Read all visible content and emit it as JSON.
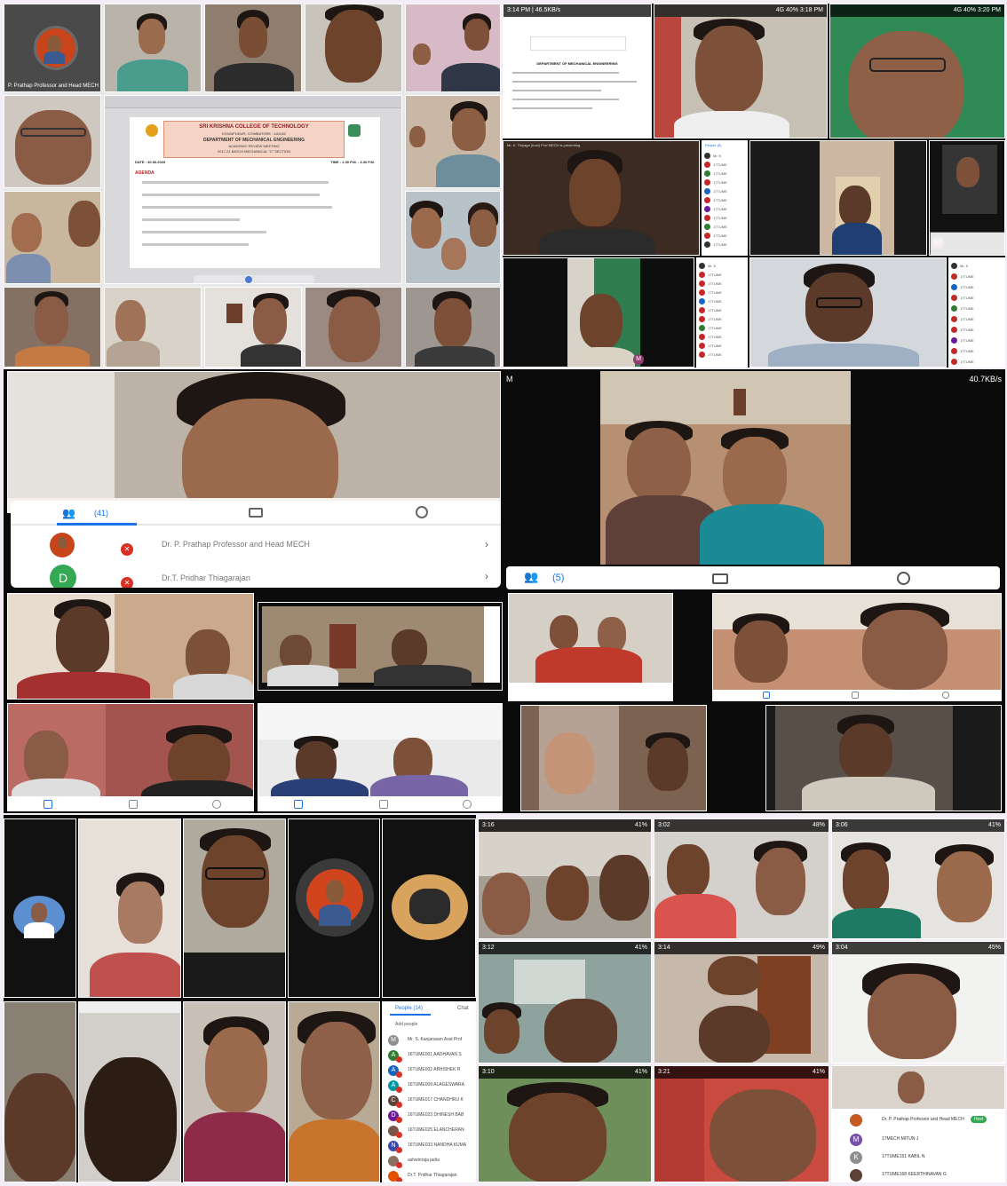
{
  "panel1": {
    "presenter_label": "P. Prathap Professor and Head MECH",
    "slide": {
      "college": "SRI KRISHNA COLLEGE OF TECHNOLOGY",
      "place": "KOVAIPUDUR, COIMBATORE - 641042",
      "dept": "DEPARTMENT OF MECHANICAL ENGINEERING",
      "meeting": "ACADEMIC REVIEW MEETING",
      "batch": "2017-21 BATCH MECHANICAL \"C\" SECTION",
      "date": "DATE : 30.06.2020",
      "time": "TIME : 2.30 P.M. - 3.30 P.M.",
      "agenda_title": "AGENDA",
      "agenda_items": [
        "",
        "",
        "",
        "",
        "",
        ""
      ]
    }
  },
  "panel2": {
    "status_left_1": "3:14 PM | 46.5KB/s",
    "status_right_1": "4G  40% 3:18 PM",
    "status_right_2": "4G  40% 3:20 PM",
    "doc_title": "DEPARTMENT OF MECHANICAL ENGINEERING",
    "presenting_label": "Mr. K. Thiyaga (host) Prof MECH is presenting",
    "people_label": "People (5)",
    "avatar_letter": "M"
  },
  "panel3": {
    "participants_count": "(41)",
    "participants": [
      {
        "name": "Dr. P. Prathap Professor and Head MECH",
        "avatar": ""
      },
      {
        "name": "Dr.T. Pridhar Thiagarajan",
        "avatar": "D"
      }
    ]
  },
  "panel4": {
    "status_left": "M",
    "status_right": "40.7KB/s",
    "participants_count": "(5)"
  },
  "panel6": {
    "status_times": [
      "3:16",
      "3:02",
      "3:06",
      "3:12",
      "3:14",
      "3:04",
      "3:10",
      "3:21"
    ],
    "battery": [
      "41%",
      "48%",
      "41%",
      "41%",
      "49%",
      "45%",
      "41%",
      "41%"
    ],
    "people_tab": "People (14)",
    "chat_tab": "Chat",
    "add_people": "Add people",
    "participants": [
      {
        "avatar": "M",
        "name": "Mr. S. Kanjarasan Asst Prof",
        "color": "#8e8e8e"
      },
      {
        "avatar": "A",
        "name": "16TUME001 AADHAVAN S",
        "color": "#2e7d32"
      },
      {
        "avatar": "A",
        "name": "16TUME002 ABHISHEK R",
        "color": "#1565c0"
      },
      {
        "avatar": "A",
        "name": "16TUME009 ALAGESWARA",
        "color": "#0097a7"
      },
      {
        "avatar": "C",
        "name": "16TUME017 CHANDHRU K",
        "color": "#5d4037"
      },
      {
        "avatar": "D",
        "name": "16TUME023 DHINESH BAB",
        "color": "#6a1b9a"
      },
      {
        "avatar": "",
        "name": "16TUME025 ELANCHERAN",
        "color": "#795548"
      },
      {
        "avatar": "N",
        "name": "16TUME033 NANDHA KUMA",
        "color": "#3949ab"
      },
      {
        "avatar": "",
        "name": "ashwinraja jadia",
        "color": "#8d6e63"
      },
      {
        "avatar": "",
        "name": "Dr.T. Pridhar Thiagarajan",
        "color": "#e65100"
      }
    ],
    "right_list": [
      {
        "avatar": "",
        "name": "Dr. P. Prathap Professor and Head MECH",
        "color": "#c45a20",
        "tag": "Host"
      },
      {
        "avatar": "M",
        "name": "17MECH MITUN J",
        "color": "#7b52ab"
      },
      {
        "avatar": "K",
        "name": "17TUME151 KABIL N",
        "color": "#8e8e8e"
      },
      {
        "avatar": "",
        "name": "17TUME168 KEERTHINAVAN G",
        "color": "#5d4037"
      }
    ]
  },
  "colors": {
    "meet_red": "#d93025",
    "meet_green": "#34a853",
    "meet_blue": "#1a73e8",
    "page_bg": "#f3eef5"
  }
}
